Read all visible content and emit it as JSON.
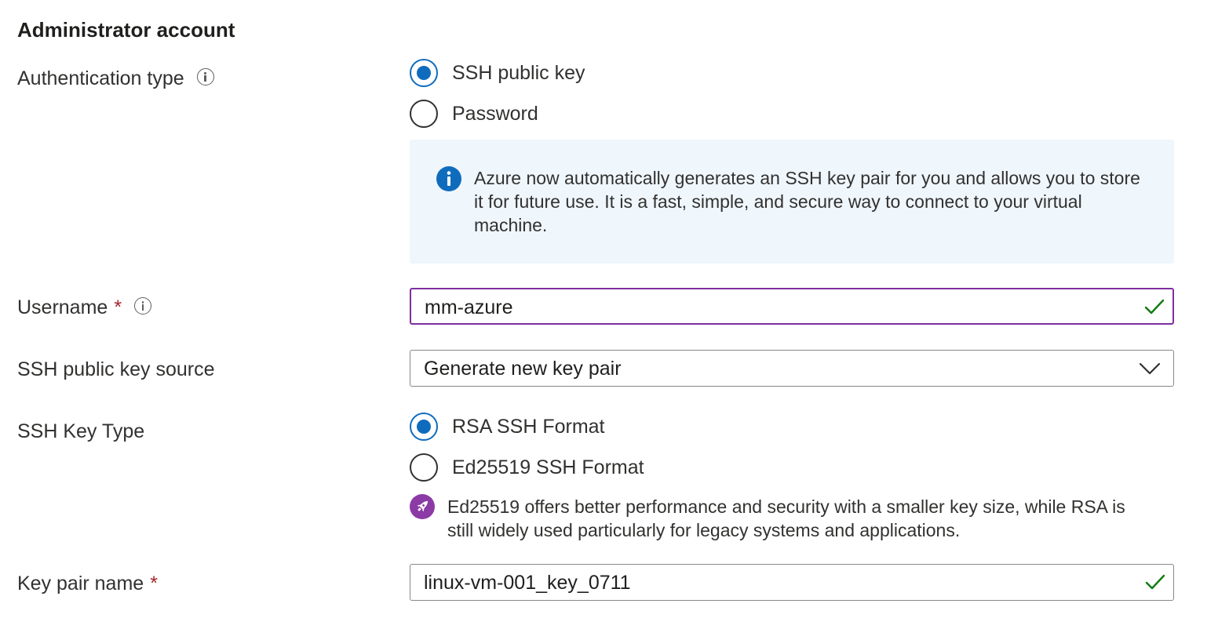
{
  "section": {
    "title": "Administrator account"
  },
  "auth": {
    "label": "Authentication type",
    "options": [
      "SSH public key",
      "Password"
    ],
    "selected": "SSH public key",
    "info_text": "Azure now automatically generates an SSH key pair for you and allows you to store it for future use. It is a fast, simple, and secure way to connect to your virtual machine."
  },
  "username": {
    "label": "Username",
    "required_mark": "*",
    "value": "mm-azure"
  },
  "key_source": {
    "label": "SSH public key source",
    "value": "Generate new key pair"
  },
  "key_type": {
    "label": "SSH Key Type",
    "options": [
      "RSA SSH Format",
      "Ed25519 SSH Format"
    ],
    "selected": "RSA SSH Format",
    "tip_text": "Ed25519 offers better performance and security with a smaller key size, while RSA is still widely used particularly for legacy systems and applications."
  },
  "key_pair_name": {
    "label": "Key pair name",
    "required_mark": "*",
    "value": "linux-vm-001_key_0711"
  },
  "colors": {
    "accent_blue": "#0f6cbd",
    "focus_purple": "#7e2fa0",
    "required_red": "#a4262c",
    "valid_green": "#107c10",
    "info_bg": "#eff6fc",
    "tip_purple": "#8c3aa6"
  },
  "icons": {
    "info_tooltip": "info-circle-icon",
    "info_banner": "info-filled-icon",
    "valid": "checkmark-icon",
    "dropdown": "chevron-down-icon",
    "tip": "rocket-icon"
  }
}
